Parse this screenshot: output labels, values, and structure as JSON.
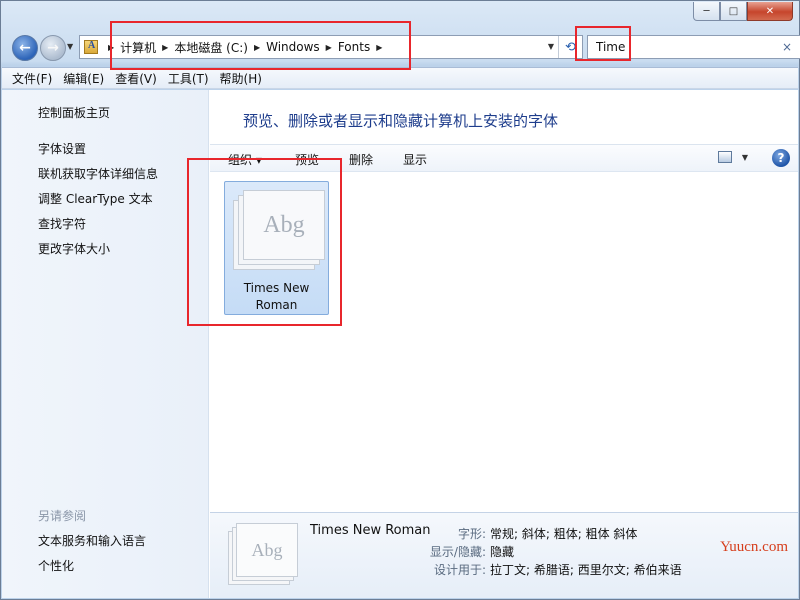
{
  "window": {
    "caption_buttons": [
      "─",
      "□",
      "✕"
    ]
  },
  "nav": {
    "back_icon": "arrow-left-icon",
    "forward_icon": "arrow-right-icon"
  },
  "address": {
    "crumbs": [
      "计算机",
      "本地磁盘 (C:)",
      "Windows",
      "Fonts"
    ],
    "refresh_icon": "refresh-icon"
  },
  "search": {
    "value": "Time",
    "clear": "×"
  },
  "menu": {
    "items": [
      "文件(F)",
      "编辑(E)",
      "查看(V)",
      "工具(T)",
      "帮助(H)"
    ]
  },
  "sidebar": {
    "home": "控制面板主页",
    "links": [
      "字体设置",
      "联机获取字体详细信息",
      "调整 ClearType 文本",
      "查找字符",
      "更改字体大小"
    ],
    "see_also_label": "另请参阅",
    "see_also_links": [
      "文本服务和输入语言",
      "个性化"
    ]
  },
  "main": {
    "title": "预览、删除或者显示和隐藏计算机上安装的字体",
    "commands": {
      "organize": "组织 ▾",
      "preview": "预览",
      "delete": "删除",
      "show": "显示"
    },
    "help": "?"
  },
  "font_tile": {
    "sample": "Abg",
    "name_line1": "Times New",
    "name_line2": "Roman"
  },
  "details": {
    "sample": "Abg",
    "name": "Times New Roman",
    "rows": [
      {
        "key": "字形:",
        "value": "常规; 斜体; 粗体; 粗体 斜体"
      },
      {
        "key": "显示/隐藏:",
        "value": "隐藏"
      },
      {
        "key": "设计用于:",
        "value": "拉丁文; 希腊语; 西里尔文; 希伯来语"
      }
    ]
  },
  "watermark": "Yuucn.com",
  "colors": {
    "annotation": "#e8262c",
    "title_blue": "#1e3d8c",
    "watermark": "#d63e1c"
  }
}
